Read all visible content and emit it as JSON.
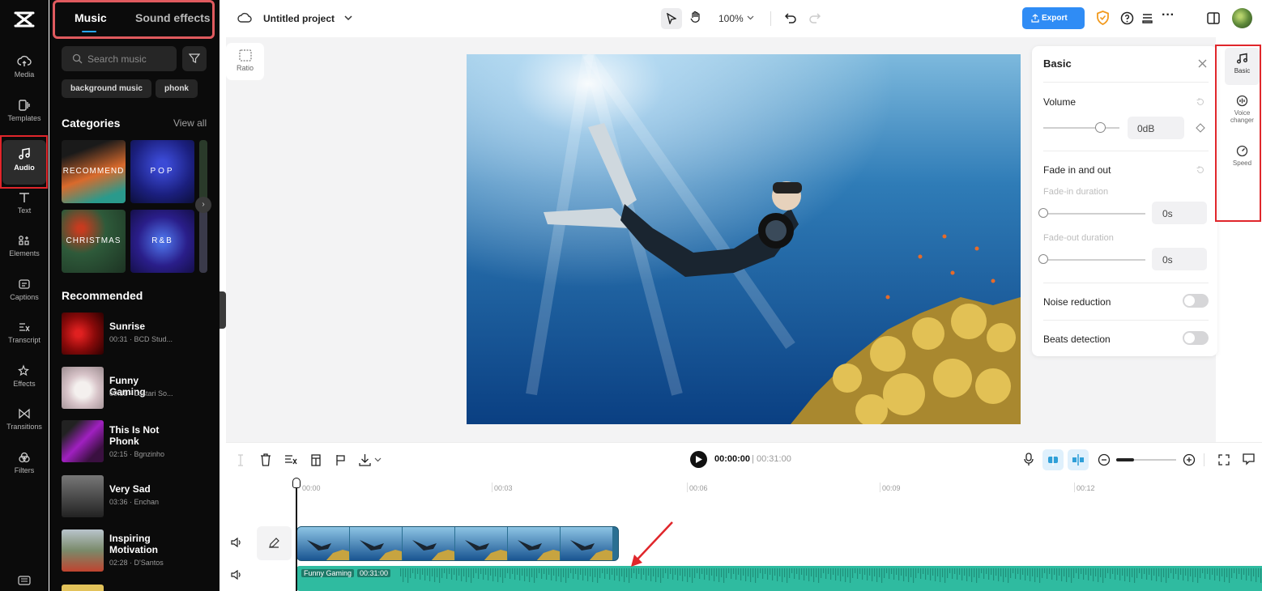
{
  "rail": {
    "items": [
      {
        "label": "Media",
        "icon": "cloud-upload-icon"
      },
      {
        "label": "Templates",
        "icon": "templates-icon"
      },
      {
        "label": "Audio",
        "icon": "music-note-icon",
        "active": true
      },
      {
        "label": "Text",
        "icon": "text-icon"
      },
      {
        "label": "Elements",
        "icon": "elements-icon"
      },
      {
        "label": "Captions",
        "icon": "captions-icon"
      },
      {
        "label": "Transcript",
        "icon": "transcript-icon"
      },
      {
        "label": "Effects",
        "icon": "effects-icon"
      },
      {
        "label": "Transitions",
        "icon": "transitions-icon"
      },
      {
        "label": "Filters",
        "icon": "filters-icon"
      }
    ]
  },
  "panel": {
    "tabs": {
      "music": "Music",
      "sound_effects": "Sound effects"
    },
    "search_placeholder": "Search music",
    "chips": [
      "background music",
      "phonk"
    ],
    "categories_title": "Categories",
    "view_all": "View all",
    "categories": [
      "RECOMMEND",
      "POP",
      "CHRISTMAS",
      "R&B"
    ],
    "recommended_title": "Recommended",
    "tracks": [
      {
        "title": "Sunrise",
        "meta": "00:31 · BCD Stud..."
      },
      {
        "title": "Funny Gaming",
        "meta": "00:31 · Lestari So..."
      },
      {
        "title": "This Is Not Phonk",
        "meta": "02:15 · Bgnzinho"
      },
      {
        "title": "Very Sad",
        "meta": "03:36 · Enchan"
      },
      {
        "title": "Inspiring Motivation",
        "meta": "02:28 · D'Santos"
      }
    ]
  },
  "topbar": {
    "project_title": "Untitled project",
    "zoom": "100%",
    "export_label": "Export"
  },
  "canvas": {
    "ratio_label": "Ratio"
  },
  "basic_panel": {
    "title": "Basic",
    "volume_label": "Volume",
    "volume_value": "0dB",
    "volume_level": 0.74,
    "fade_label": "Fade in and out",
    "fade_in_label": "Fade-in duration",
    "fade_in_value": "0s",
    "fade_out_label": "Fade-out duration",
    "fade_out_value": "0s",
    "noise_label": "Noise reduction",
    "beats_label": "Beats detection"
  },
  "prop_rail": {
    "basic": "Basic",
    "voice_changer": "Voice changer",
    "speed": "Speed"
  },
  "timeline": {
    "current_time": "00:00:00",
    "total_time": "00:31:00",
    "ruler": [
      "00:00",
      "00:03",
      "00:06",
      "00:09",
      "00:12"
    ],
    "audio_track_name": "Funny Gaming",
    "audio_track_duration": "00:31:00"
  },
  "colors": {
    "accent": "#2f8cf5",
    "highlight": "#e0262b",
    "audio_track": "#2fbba0"
  }
}
